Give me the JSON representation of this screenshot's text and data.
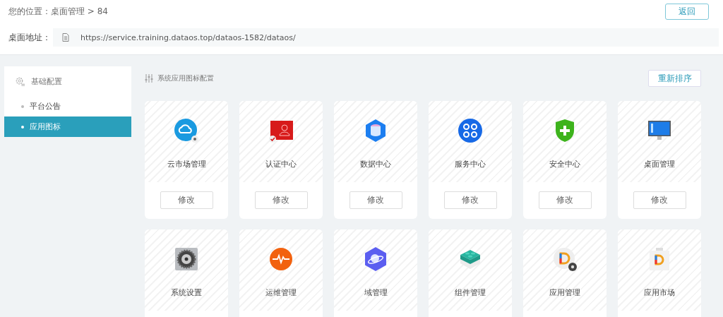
{
  "breadcrumb": {
    "label": "您的位置：",
    "path": "桌面管理 > 84"
  },
  "back_button": "返回",
  "address": {
    "label": "桌面地址：",
    "value": "https://service.training.dataos.top/dataos-1582/dataos/"
  },
  "sidebar": {
    "group": "基础配置",
    "items": [
      {
        "label": "平台公告",
        "selected": false
      },
      {
        "label": "应用图标",
        "selected": true
      }
    ]
  },
  "section_title": "系统应用图标配置",
  "reorder_button": "重新排序",
  "cards": [
    {
      "name": "云市场管理",
      "kind": "cloud",
      "button": "修改"
    },
    {
      "name": "认证中心",
      "kind": "certificate",
      "button": "修改"
    },
    {
      "name": "数据中心",
      "kind": "database",
      "button": "修改"
    },
    {
      "name": "服务中心",
      "kind": "service",
      "button": "修改"
    },
    {
      "name": "安全中心",
      "kind": "shield",
      "button": "修改"
    },
    {
      "name": "桌面管理",
      "kind": "monitor",
      "button": "修改"
    },
    {
      "name": "系统设置",
      "kind": "gear"
    },
    {
      "name": "运维管理",
      "kind": "pulse"
    },
    {
      "name": "域管理",
      "kind": "planet"
    },
    {
      "name": "组件管理",
      "kind": "block"
    },
    {
      "name": "应用管理",
      "kind": "app-gear"
    },
    {
      "name": "应用市场",
      "kind": "app-store"
    }
  ]
}
